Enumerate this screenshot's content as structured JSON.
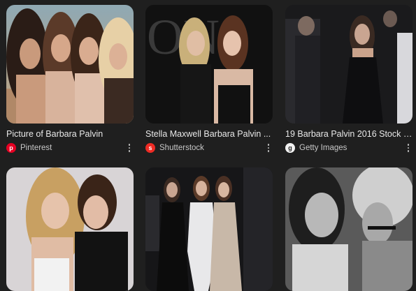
{
  "results": [
    {
      "title": "Picture of Barbara Palvin",
      "source": "Pinterest",
      "source_icon": "pinterest-icon",
      "source_color": "#e60023",
      "source_glyph": "p"
    },
    {
      "title": "Stella Maxwell Barbara Palvin ...",
      "source": "Shutterstock",
      "source_icon": "shutterstock-icon",
      "source_color": "#ee2b24",
      "source_glyph": "s"
    },
    {
      "title": "19 Barbara Palvin 2016 Stock V...",
      "source": "Getty Images",
      "source_icon": "getty-images-icon",
      "source_color": "#f1f1f1",
      "source_glyph": "g"
    },
    {
      "title": "",
      "source": ""
    },
    {
      "title": "",
      "source": ""
    },
    {
      "title": "",
      "source": ""
    }
  ],
  "colors": {
    "background": "#1f1f1f",
    "title_text": "#e8e8e8",
    "source_text": "#c8c8c8"
  }
}
